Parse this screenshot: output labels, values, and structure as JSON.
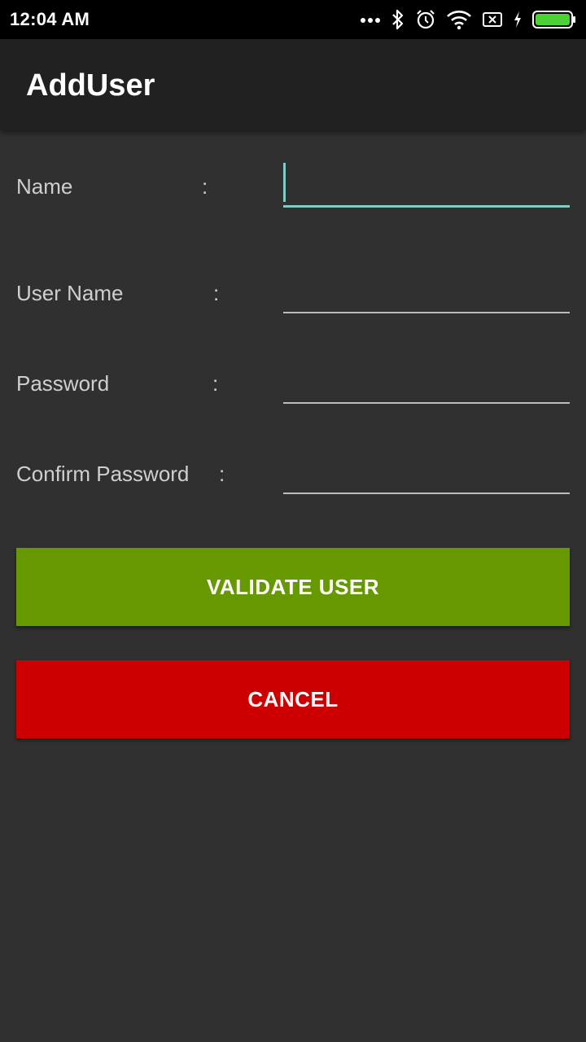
{
  "status_bar": {
    "time": "12:04 AM",
    "icons": [
      "more-dots-icon",
      "bluetooth-icon",
      "alarm-icon",
      "wifi-icon",
      "sim-off-icon",
      "charging-icon",
      "battery-icon"
    ]
  },
  "app_bar": {
    "title": "AddUser"
  },
  "form": {
    "name": {
      "label": "Name",
      "colon": ":",
      "value": ""
    },
    "username": {
      "label": "User Name",
      "colon": ":",
      "value": ""
    },
    "password": {
      "label": "Password",
      "colon": ":",
      "value": ""
    },
    "confirm_password": {
      "label": "Confirm Password",
      "colon": ":",
      "value": ""
    }
  },
  "buttons": {
    "validate_label": "VALIDATE USER",
    "cancel_label": "CANCEL"
  },
  "colors": {
    "accent": "#80cbc4",
    "validate": "#669900",
    "cancel": "#cc0000",
    "background": "#303030",
    "app_bar": "#212121",
    "battery": "#4cd137"
  }
}
